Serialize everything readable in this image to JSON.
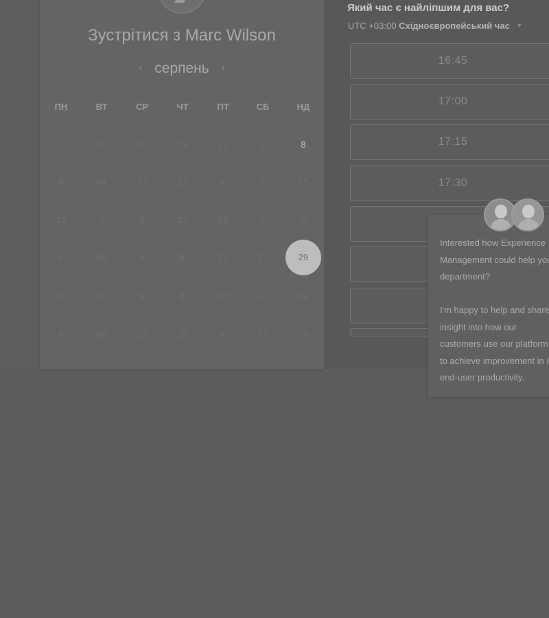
{
  "meeting": {
    "title": "Зустрітися з Marc Wilson",
    "month": "серпень",
    "prev_icon": "chevron-left-icon",
    "next_icon": "chevron-right-icon"
  },
  "weekdays": [
    "ПН",
    "ВТ",
    "СР",
    "ЧТ",
    "ПТ",
    "СБ",
    "НД"
  ],
  "weeks": [
    [
      "1",
      "27",
      "25",
      "19",
      "15",
      "6",
      "8"
    ],
    [
      "8",
      "24",
      "17",
      "23",
      "4",
      "6",
      "25"
    ],
    [
      "10",
      "7",
      "2",
      "23",
      "29",
      "3",
      "6"
    ],
    [
      "8",
      "28",
      "4",
      "20",
      "23",
      "27",
      "29"
    ],
    [
      "9",
      "18",
      "6",
      "6",
      "30",
      "31",
      "24"
    ],
    [
      "9",
      "26",
      "29",
      "15",
      "4",
      "21",
      "19"
    ]
  ],
  "schedule": {
    "question": "Який час є найліпшим для вас?",
    "tz_offset": "UTC +03:00",
    "tz_name": "Східноєвропейський час",
    "tz_caret": "▼",
    "slots": [
      "16:45",
      "17:00",
      "17:15",
      "17:30",
      "",
      "",
      "",
      ""
    ]
  },
  "chat": {
    "message": "Interested how Experience Management could help your department?\n\nI'm happy to help and share insight into how our customers use our platform to achieve improvement in IT end-user productivity."
  }
}
